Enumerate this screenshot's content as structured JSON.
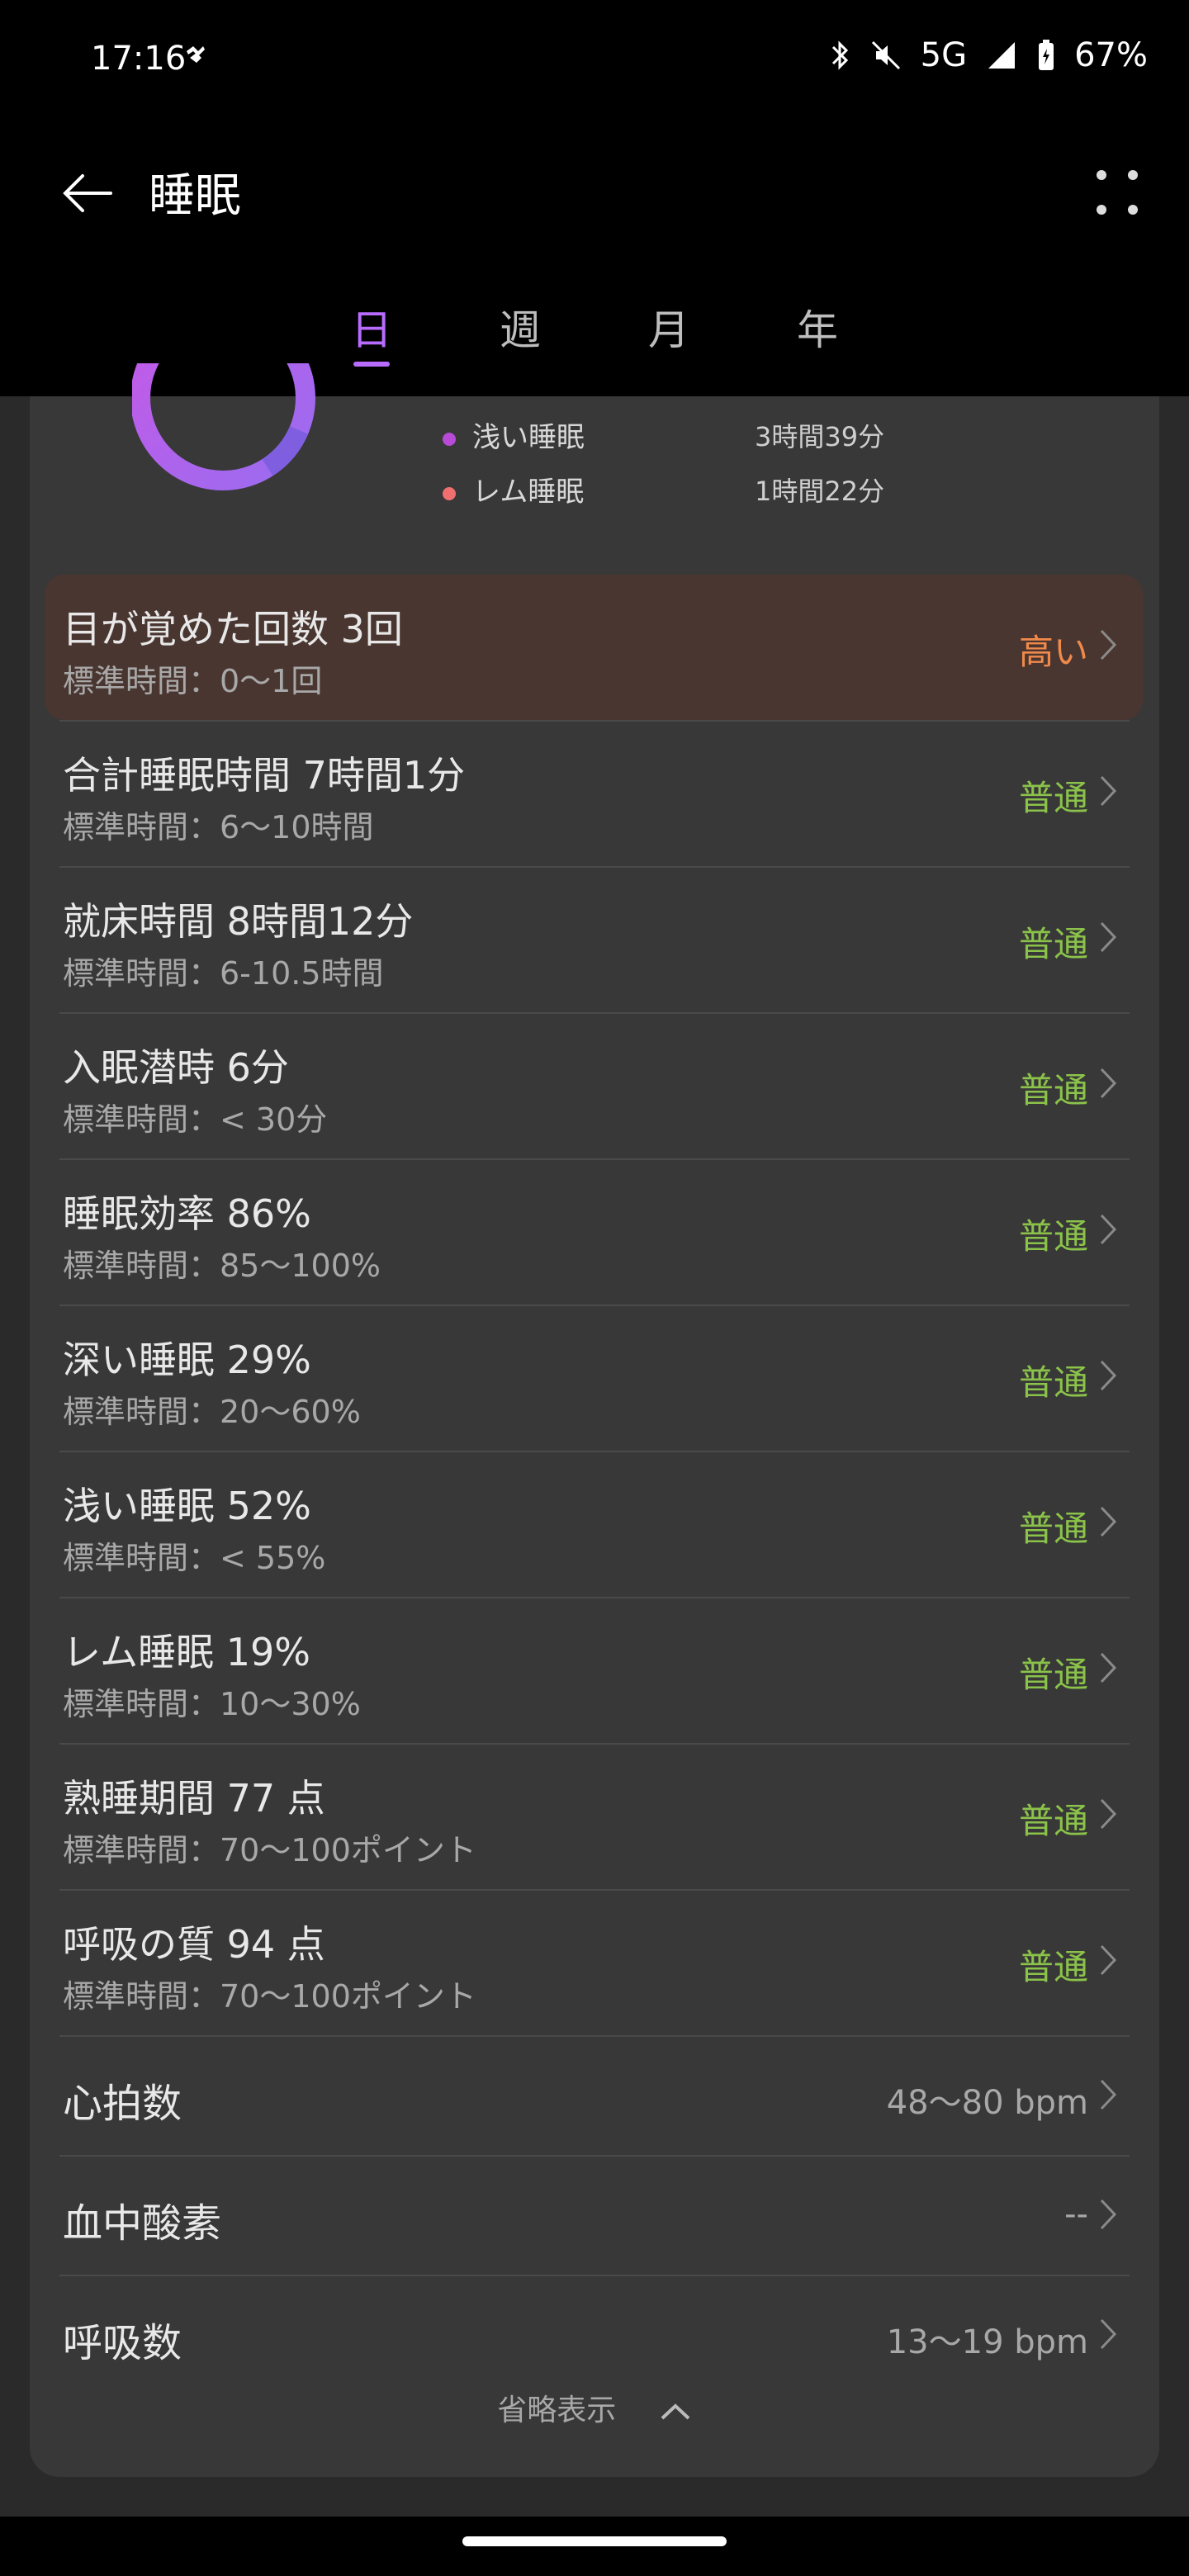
{
  "status_bar": {
    "time": "17:16",
    "network": "5G",
    "battery": "67%"
  },
  "app_bar": {
    "title": "睡眠"
  },
  "tabs": [
    {
      "label": "日",
      "active": true
    },
    {
      "label": "週",
      "active": false
    },
    {
      "label": "月",
      "active": false
    },
    {
      "label": "年",
      "active": false
    }
  ],
  "legend": [
    {
      "label": "浅い睡眠",
      "value": "3時間39分",
      "color": "#b84ad8"
    },
    {
      "label": "レム睡眠",
      "value": "1時間22分",
      "color": "#f07070"
    }
  ],
  "metrics": [
    {
      "title": "目が覚めた回数  3回",
      "sub": "標準時間：0〜1回",
      "status": "高い",
      "status_color": "#f08a4b",
      "highlight": true
    },
    {
      "title": "合計睡眠時間  7時間1分",
      "sub": "標準時間：6〜10時間",
      "status": "普通",
      "status_color": "#8bc34a"
    },
    {
      "title": "就床時間  8時間12分",
      "sub": "標準時間：6-10.5時間",
      "status": "普通",
      "status_color": "#8bc34a"
    },
    {
      "title": "入眠潜時 6分",
      "sub": "標準時間：< 30分",
      "status": "普通",
      "status_color": "#8bc34a"
    },
    {
      "title": "睡眠効率  86%",
      "sub": "標準時間：85〜100%",
      "status": "普通",
      "status_color": "#8bc34a"
    },
    {
      "title": "深い睡眠  29%",
      "sub": "標準時間：20〜60%",
      "status": "普通",
      "status_color": "#8bc34a"
    },
    {
      "title": "浅い睡眠  52%",
      "sub": "標準時間：< 55%",
      "status": "普通",
      "status_color": "#8bc34a"
    },
    {
      "title": "レム睡眠  19%",
      "sub": "標準時間：10〜30%",
      "status": "普通",
      "status_color": "#8bc34a"
    },
    {
      "title": "熟睡期間  77 点",
      "sub": "標準時間：70〜100ポイント",
      "status": "普通",
      "status_color": "#8bc34a"
    },
    {
      "title": "呼吸の質  94 点",
      "sub": "標準時間：70〜100ポイント",
      "status": "普通",
      "status_color": "#8bc34a"
    }
  ],
  "simple_rows": [
    {
      "title": "心拍数",
      "value": "48〜80 bpm"
    },
    {
      "title": "血中酸素",
      "value": "--"
    },
    {
      "title": "呼吸数",
      "value": "13〜19 bpm"
    }
  ],
  "collapse_label": "省略表示"
}
